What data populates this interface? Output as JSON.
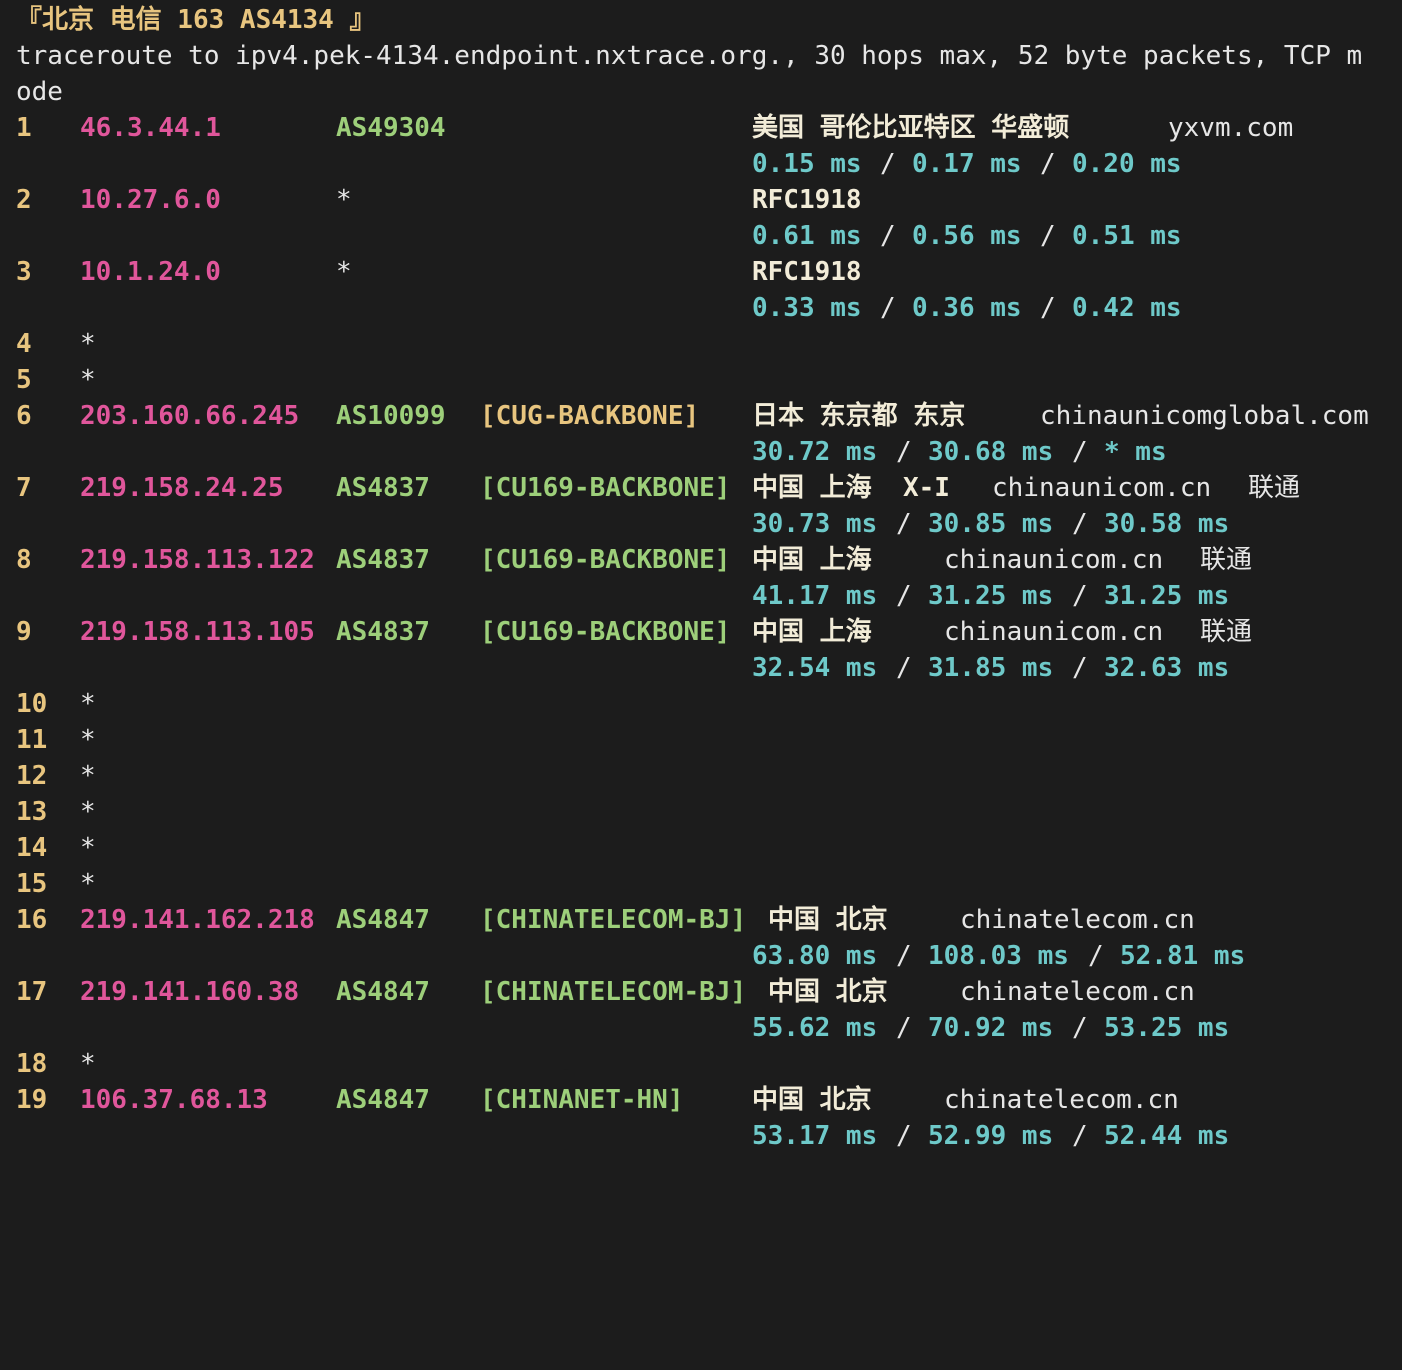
{
  "header": "『北京 电信 163 AS4134 』",
  "command_line_1": "traceroute to ipv4.pek-4134.endpoint.nxtrace.org., 30 hops max, 52 byte packets, TCP m",
  "command_line_2": "ode",
  "hops": [
    {
      "n": "1",
      "ip": "46.3.44.1",
      "asn": "AS49304",
      "tag": "",
      "geo": "美国 哥伦比亚特区 华盛顿",
      "domain": "yxvm.com",
      "isp": "",
      "rtt": [
        "0.15 ms",
        "0.17 ms",
        "0.20 ms"
      ]
    },
    {
      "n": "2",
      "ip": "10.27.6.0",
      "asn": "*",
      "tag": "",
      "geo": "RFC1918",
      "domain": "",
      "isp": "",
      "rtt": [
        "0.61 ms",
        "0.56 ms",
        "0.51 ms"
      ]
    },
    {
      "n": "3",
      "ip": "10.1.24.0",
      "asn": "*",
      "tag": "",
      "geo": "RFC1918",
      "domain": "",
      "isp": "",
      "rtt": [
        "0.33 ms",
        "0.36 ms",
        "0.42 ms"
      ]
    },
    {
      "n": "4",
      "ip": "*"
    },
    {
      "n": "5",
      "ip": "*"
    },
    {
      "n": "6",
      "ip": "203.160.66.245",
      "asn": "AS10099",
      "tag": "[CUG-BACKBONE]",
      "geo": "日本 东京都 东京",
      "domain": "chinaunicomglobal.com",
      "isp": "",
      "rtt": [
        "30.72 ms",
        "30.68 ms",
        "* ms"
      ]
    },
    {
      "n": "7",
      "ip": "219.158.24.25",
      "asn": "AS4837",
      "tag": "[CU169-BACKBONE]",
      "geo": "中国 上海  X-I",
      "domain": "chinaunicom.cn",
      "isp": "联通",
      "rtt": [
        "30.73 ms",
        "30.85 ms",
        "30.58 ms"
      ]
    },
    {
      "n": "8",
      "ip": "219.158.113.122",
      "asn": "AS4837",
      "tag": "[CU169-BACKBONE]",
      "geo": "中国 上海",
      "domain": "chinaunicom.cn",
      "isp": "联通",
      "rtt": [
        "41.17 ms",
        "31.25 ms",
        "31.25 ms"
      ]
    },
    {
      "n": "9",
      "ip": "219.158.113.105",
      "asn": "AS4837",
      "tag": "[CU169-BACKBONE]",
      "geo": "中国 上海",
      "domain": "chinaunicom.cn",
      "isp": "联通",
      "rtt": [
        "32.54 ms",
        "31.85 ms",
        "32.63 ms"
      ]
    },
    {
      "n": "10",
      "ip": "*"
    },
    {
      "n": "11",
      "ip": "*"
    },
    {
      "n": "12",
      "ip": "*"
    },
    {
      "n": "13",
      "ip": "*"
    },
    {
      "n": "14",
      "ip": "*"
    },
    {
      "n": "15",
      "ip": "*"
    },
    {
      "n": "16",
      "ip": "219.141.162.218",
      "asn": "AS4847",
      "tag": "[CHINATELECOM-BJ]",
      "geo": "中国 北京",
      "domain": "chinatelecom.cn",
      "isp": "",
      "rtt": [
        "63.80 ms",
        "108.03 ms",
        "52.81 ms"
      ]
    },
    {
      "n": "17",
      "ip": "219.141.160.38",
      "asn": "AS4847",
      "tag": "[CHINATELECOM-BJ]",
      "geo": "中国 北京",
      "domain": "chinatelecom.cn",
      "isp": "",
      "rtt": [
        "55.62 ms",
        "70.92 ms",
        "53.25 ms"
      ]
    },
    {
      "n": "18",
      "ip": "*"
    },
    {
      "n": "19",
      "ip": "106.37.68.13",
      "asn": "AS4847",
      "tag": "[CHINANET-HN]",
      "geo": "中国 北京",
      "domain": "chinatelecom.cn",
      "isp": "",
      "rtt": [
        "53.17 ms",
        "52.99 ms",
        "52.44 ms"
      ]
    }
  ],
  "colors": {
    "background": "#1c1c1c",
    "hop_number": "#e8c57f",
    "ip": "#e0569b",
    "asn": "#9dcf7a",
    "tag_backbone": "#9dcf7a",
    "tag_cug": "#e8c57f",
    "rtt": "#6ec9c9",
    "text": "#e6e6e6"
  }
}
